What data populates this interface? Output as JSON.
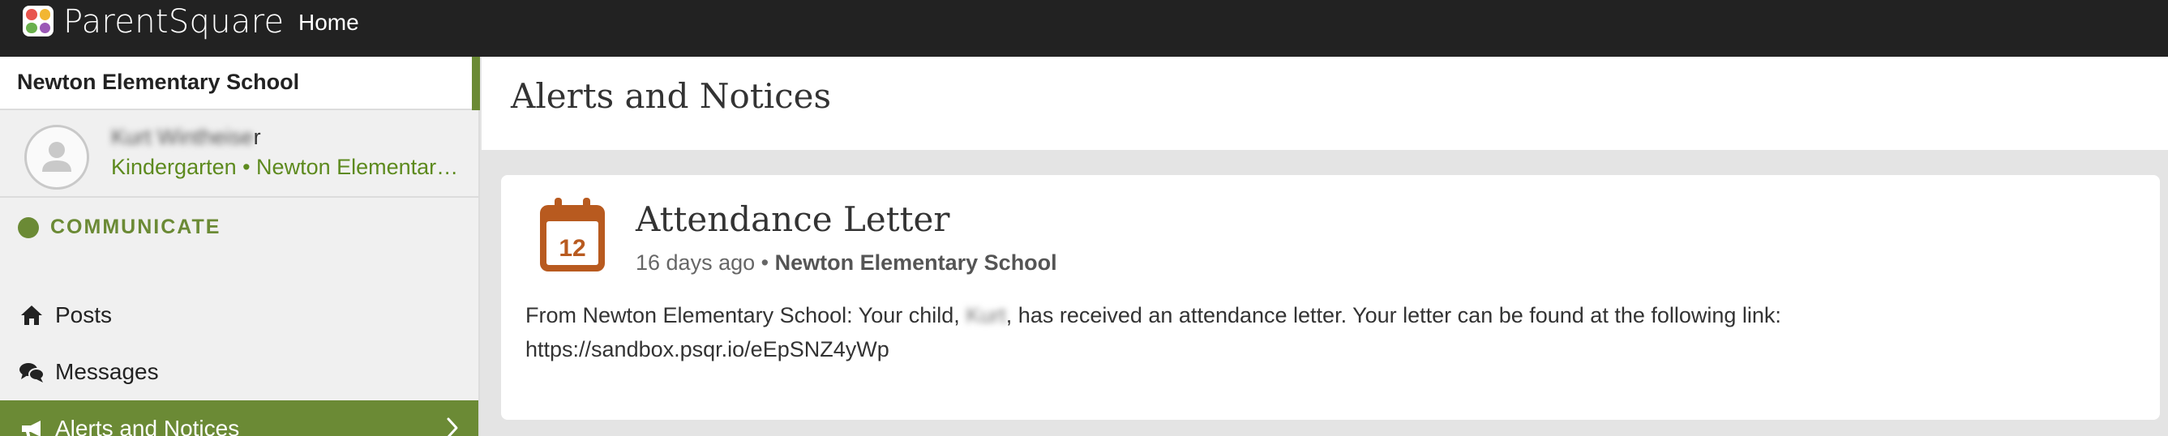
{
  "topbar": {
    "brand": "ParentSquare",
    "nav_home": "Home",
    "logo_colors": [
      "#e8554e",
      "#f2b632",
      "#6ab04c",
      "#9b59b6"
    ]
  },
  "sidebar": {
    "school_name": "Newton Elementary School",
    "profile": {
      "name_blurred": "Kurt Wintheise",
      "name_suffix": "r",
      "subtitle": "Kindergarten • Newton Elementary School"
    },
    "section": "COMMUNICATE",
    "items": [
      {
        "label": "Posts",
        "icon": "home-icon"
      },
      {
        "label": "Messages",
        "icon": "chat-bubbles-icon"
      },
      {
        "label": "Alerts and Notices",
        "icon": "megaphone-icon",
        "active": true
      }
    ]
  },
  "main": {
    "title": "Alerts and Notices",
    "alert": {
      "calendar_day": "12",
      "title": "Attendance Letter",
      "time": "16 days ago",
      "separator": " • ",
      "school": "Newton Elementary School",
      "body_before": "From Newton Elementary School: Your child, ",
      "body_child_blurred": "Kurt",
      "body_after": ", has received an attendance letter. Your letter can be found at the following link:",
      "link": "https://sandbox.psqr.io/eEpSNZ4yWp"
    }
  },
  "colors": {
    "topbar": "#222222",
    "accent_green": "#6b8a35",
    "subtitle_green": "#5d8a1e",
    "calendar_orange": "#b85a1f"
  }
}
